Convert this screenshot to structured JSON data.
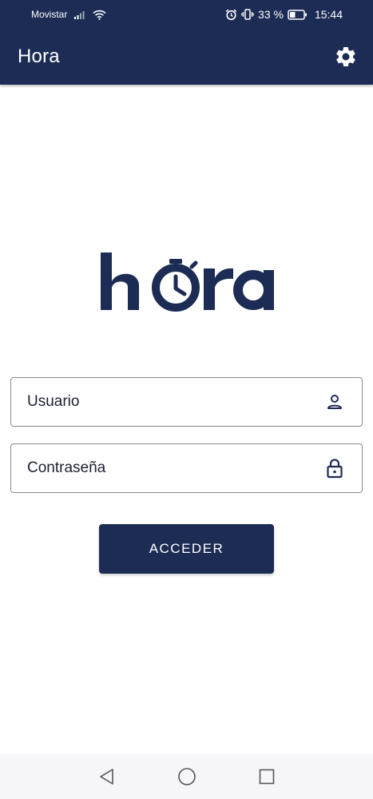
{
  "status_bar": {
    "carrier": "Movistar",
    "battery": "33 %",
    "time": "15:44"
  },
  "app_bar": {
    "title": "Hora"
  },
  "login": {
    "username_placeholder": "Usuario",
    "password_placeholder": "Contraseña",
    "submit_label": "ACCEDER"
  },
  "colors": {
    "primary": "#1c2c55",
    "border": "#8a8a8a",
    "nav_bg": "#f6f6f8"
  },
  "icons": {
    "settings": "gear-icon",
    "user": "user-icon",
    "lock": "lock-icon",
    "back": "back-triangle-icon",
    "home": "home-circle-icon",
    "recents": "recents-square-icon"
  }
}
